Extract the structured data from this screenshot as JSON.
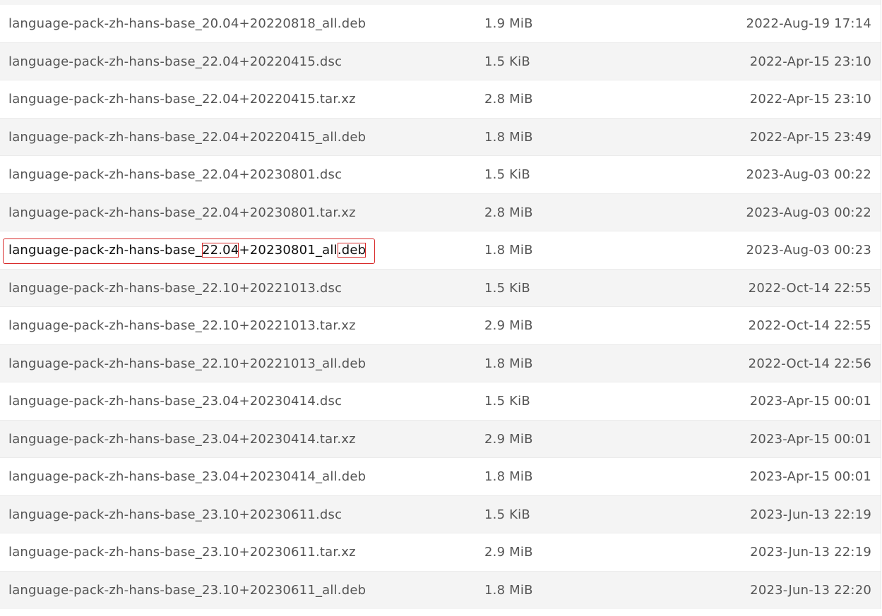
{
  "listing": {
    "rows": [
      {
        "name": "language-pack-zh-hans-base_20.04+20220818_all.deb",
        "size": "1.9 MiB",
        "date": "2022-Aug-19 17:14"
      },
      {
        "name": "language-pack-zh-hans-base_22.04+20220415.dsc",
        "size": "1.5 KiB",
        "date": "2022-Apr-15 23:10"
      },
      {
        "name": "language-pack-zh-hans-base_22.04+20220415.tar.xz",
        "size": "2.8 MiB",
        "date": "2022-Apr-15 23:10"
      },
      {
        "name": "language-pack-zh-hans-base_22.04+20220415_all.deb",
        "size": "1.8 MiB",
        "date": "2022-Apr-15 23:49"
      },
      {
        "name": "language-pack-zh-hans-base_22.04+20230801.dsc",
        "size": "1.5 KiB",
        "date": "2023-Aug-03 00:22"
      },
      {
        "name": "language-pack-zh-hans-base_22.04+20230801.tar.xz",
        "size": "2.8 MiB",
        "date": "2023-Aug-03 00:22"
      },
      {
        "name": "language-pack-zh-hans-base_22.04+20230801_all.deb",
        "size": "1.8 MiB",
        "date": "2023-Aug-03 00:23",
        "parts": {
          "prefix": "language-pack-zh-hans-base_",
          "version": "22.04",
          "middle": "+20230801_all",
          "ext": ".deb"
        }
      },
      {
        "name": "language-pack-zh-hans-base_22.10+20221013.dsc",
        "size": "1.5 KiB",
        "date": "2022-Oct-14 22:55"
      },
      {
        "name": "language-pack-zh-hans-base_22.10+20221013.tar.xz",
        "size": "2.9 MiB",
        "date": "2022-Oct-14 22:55"
      },
      {
        "name": "language-pack-zh-hans-base_22.10+20221013_all.deb",
        "size": "1.8 MiB",
        "date": "2022-Oct-14 22:56"
      },
      {
        "name": "language-pack-zh-hans-base_23.04+20230414.dsc",
        "size": "1.5 KiB",
        "date": "2023-Apr-15 00:01"
      },
      {
        "name": "language-pack-zh-hans-base_23.04+20230414.tar.xz",
        "size": "2.9 MiB",
        "date": "2023-Apr-15 00:01"
      },
      {
        "name": "language-pack-zh-hans-base_23.04+20230414_all.deb",
        "size": "1.8 MiB",
        "date": "2023-Apr-15 00:01"
      },
      {
        "name": "language-pack-zh-hans-base_23.10+20230611.dsc",
        "size": "1.5 KiB",
        "date": "2023-Jun-13 22:19"
      },
      {
        "name": "language-pack-zh-hans-base_23.10+20230611.tar.xz",
        "size": "2.9 MiB",
        "date": "2023-Jun-13 22:19"
      },
      {
        "name": "language-pack-zh-hans-base_23.10+20230611_all.deb",
        "size": "1.8 MiB",
        "date": "2023-Jun-13 22:20"
      }
    ]
  },
  "colors": {
    "text": "#555555",
    "row_alt": "#f4f4f4",
    "highlight": "#d92a2a"
  }
}
